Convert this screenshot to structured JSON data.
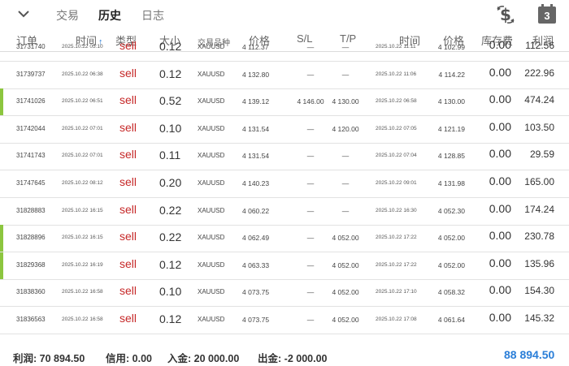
{
  "nav": {
    "tabs": [
      {
        "label": "交易",
        "active": false
      },
      {
        "label": "历史",
        "active": true
      },
      {
        "label": "日志",
        "active": false
      }
    ],
    "dollar_icon": "currency-exchange-icon",
    "calendar_icon": "calendar-icon",
    "calendar_day": "3"
  },
  "columns": {
    "order": "订单",
    "time": "时间",
    "sort_arrow": "↑",
    "type": "类型",
    "volume": "大小",
    "symbol": "交易品种",
    "price": "价格",
    "sl": "S/L",
    "tp": "T/P",
    "close_time": "时间",
    "close_price": "价格",
    "swap": "库存费",
    "profit": "利润"
  },
  "rows": [
    {
      "order": "31731740",
      "time": "2025.10.22 05:10",
      "type": "sell",
      "volume": "0.12",
      "symbol": "XAUUSD",
      "price": "4 112.37",
      "sl": "—",
      "tp": "—",
      "close_time": "2025.10.22 11:11",
      "close_price": "4 102.99",
      "swap": "0.00",
      "profit": "112.56",
      "marked": false
    },
    {
      "order": "31739737",
      "time": "2025.10.22 06:38",
      "type": "sell",
      "volume": "0.12",
      "symbol": "XAUUSD",
      "price": "4 132.80",
      "sl": "—",
      "tp": "—",
      "close_time": "2025.10.22 11:06",
      "close_price": "4 114.22",
      "swap": "0.00",
      "profit": "222.96",
      "marked": false
    },
    {
      "order": "31741026",
      "time": "2025.10.22 06:51",
      "type": "sell",
      "volume": "0.52",
      "symbol": "XAUUSD",
      "price": "4 139.12",
      "sl": "4 146.00",
      "tp": "4 130.00",
      "close_time": "2025.10.22 06:58",
      "close_price": "4 130.00",
      "swap": "0.00",
      "profit": "474.24",
      "marked": true
    },
    {
      "order": "31742044",
      "time": "2025.10.22 07:01",
      "type": "sell",
      "volume": "0.10",
      "symbol": "XAUUSD",
      "price": "4 131.54",
      "sl": "—",
      "tp": "4 120.00",
      "close_time": "2025.10.22 07:05",
      "close_price": "4 121.19",
      "swap": "0.00",
      "profit": "103.50",
      "marked": false
    },
    {
      "order": "31741743",
      "time": "2025.10.22 07:01",
      "type": "sell",
      "volume": "0.11",
      "symbol": "XAUUSD",
      "price": "4 131.54",
      "sl": "—",
      "tp": "—",
      "close_time": "2025.10.22 07:04",
      "close_price": "4 128.85",
      "swap": "0.00",
      "profit": "29.59",
      "marked": false
    },
    {
      "order": "31747645",
      "time": "2025.10.22 08:12",
      "type": "sell",
      "volume": "0.20",
      "symbol": "XAUUSD",
      "price": "4 140.23",
      "sl": "—",
      "tp": "—",
      "close_time": "2025.10.22 09:01",
      "close_price": "4 131.98",
      "swap": "0.00",
      "profit": "165.00",
      "marked": false
    },
    {
      "order": "31828883",
      "time": "2025.10.22 16:15",
      "type": "sell",
      "volume": "0.22",
      "symbol": "XAUUSD",
      "price": "4 060.22",
      "sl": "—",
      "tp": "—",
      "close_time": "2025.10.22 16:30",
      "close_price": "4 052.30",
      "swap": "0.00",
      "profit": "174.24",
      "marked": false
    },
    {
      "order": "31828896",
      "time": "2025.10.22 16:15",
      "type": "sell",
      "volume": "0.22",
      "symbol": "XAUUSD",
      "price": "4 062.49",
      "sl": "—",
      "tp": "4 052.00",
      "close_time": "2025.10.22 17:22",
      "close_price": "4 052.00",
      "swap": "0.00",
      "profit": "230.78",
      "marked": true
    },
    {
      "order": "31829368",
      "time": "2025.10.22 16:19",
      "type": "sell",
      "volume": "0.12",
      "symbol": "XAUUSD",
      "price": "4 063.33",
      "sl": "—",
      "tp": "4 052.00",
      "close_time": "2025.10.22 17:22",
      "close_price": "4 052.00",
      "swap": "0.00",
      "profit": "135.96",
      "marked": true
    },
    {
      "order": "31838360",
      "time": "2025.10.22 16:58",
      "type": "sell",
      "volume": "0.10",
      "symbol": "XAUUSD",
      "price": "4 073.75",
      "sl": "—",
      "tp": "4 052.00",
      "close_time": "2025.10.22 17:10",
      "close_price": "4 058.32",
      "swap": "0.00",
      "profit": "154.30",
      "marked": false
    },
    {
      "order": "31836563",
      "time": "2025.10.22 16:58",
      "type": "sell",
      "volume": "0.12",
      "symbol": "XAUUSD",
      "price": "4 073.75",
      "sl": "—",
      "tp": "4 052.00",
      "close_time": "2025.10.22 17:08",
      "close_price": "4 061.64",
      "swap": "0.00",
      "profit": "145.32",
      "marked": false
    }
  ],
  "summary": {
    "profit_label": "利润:",
    "profit_value": "70 894.50",
    "credit_label": "信用:",
    "credit_value": "0.00",
    "deposit_label": "入金:",
    "deposit_value": "20 000.00",
    "withdraw_label": "出金:",
    "withdraw_value": "-2 000.00",
    "total": "88 894.50"
  },
  "colors": {
    "sell": "#c62828",
    "accent": "#2a7ed8",
    "marker": "#8cc63f"
  }
}
